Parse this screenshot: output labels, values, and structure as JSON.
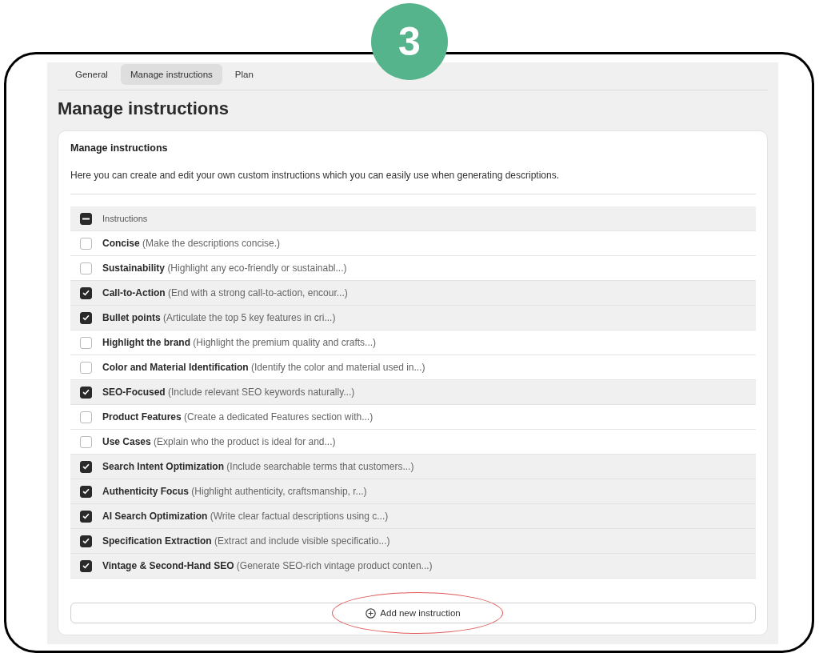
{
  "step_badge": "3",
  "tabs": [
    {
      "label": "General",
      "selected": false
    },
    {
      "label": "Manage instructions",
      "selected": true
    },
    {
      "label": "Plan",
      "selected": false
    }
  ],
  "heading": "Manage instructions",
  "card": {
    "title": "Manage instructions",
    "description": "Here you can create and edit your own custom instructions which you can easily use when generating descriptions."
  },
  "table": {
    "header": {
      "label": "Instructions",
      "indeterminate": true
    },
    "rows": [
      {
        "name": "Concise",
        "description": "(Make the descriptions concise.)",
        "checked": false
      },
      {
        "name": "Sustainability",
        "description": "(Highlight any eco-friendly or sustainabl...)",
        "checked": false
      },
      {
        "name": "Call-to-Action",
        "description": "(End with a strong call-to-action, encour...)",
        "checked": true
      },
      {
        "name": "Bullet points",
        "description": "(Articulate the top 5 key features in cri...)",
        "checked": true
      },
      {
        "name": "Highlight the brand",
        "description": "(Highlight the premium quality and crafts...)",
        "checked": false
      },
      {
        "name": "Color and Material Identification",
        "description": "(Identify the color and material used in...)",
        "checked": false
      },
      {
        "name": "SEO-Focused",
        "description": "(Include relevant SEO keywords naturally...)",
        "checked": true
      },
      {
        "name": "Product Features",
        "description": "(Create a dedicated Features section with...)",
        "checked": false
      },
      {
        "name": "Use Cases",
        "description": "(Explain who the product is ideal for and...)",
        "checked": false
      },
      {
        "name": "Search Intent Optimization",
        "description": "(Include searchable terms that customers...)",
        "checked": true
      },
      {
        "name": "Authenticity Focus",
        "description": "(Highlight authenticity, craftsmanship, r...)",
        "checked": true
      },
      {
        "name": "AI Search Optimization",
        "description": "(Write clear factual descriptions using c...)",
        "checked": true
      },
      {
        "name": "Specification Extraction",
        "description": "(Extract and include visible specificatio...)",
        "checked": true
      },
      {
        "name": "Vintage & Second-Hand SEO",
        "description": "(Generate SEO-rich vintage product conten...)",
        "checked": true
      }
    ]
  },
  "add_button": {
    "label": "Add new instruction",
    "circled": true
  }
}
